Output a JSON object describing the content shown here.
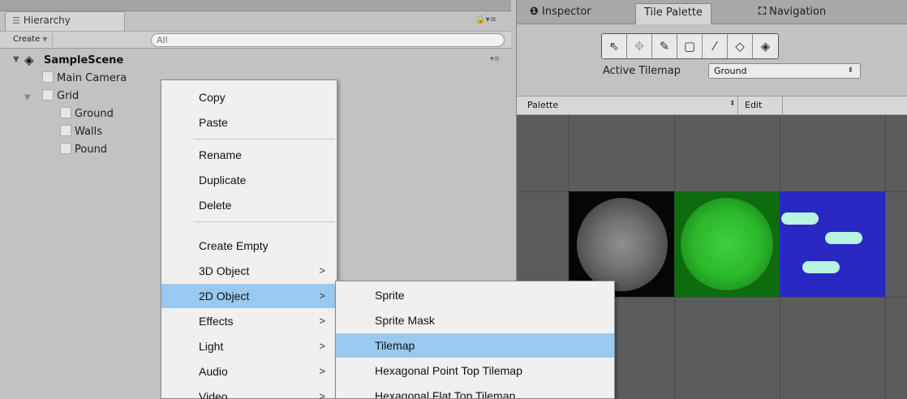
{
  "hierarchy": {
    "tab_label": "Hierarchy",
    "create_label": "Create",
    "search_placeholder": "All",
    "scene_name": "SampleScene",
    "items": [
      {
        "label": "Main Camera"
      },
      {
        "label": "Grid"
      },
      {
        "label": "Ground"
      },
      {
        "label": "Walls"
      },
      {
        "label": "Pound"
      }
    ]
  },
  "tabs": {
    "inspector": "Inspector",
    "tile_palette": "Tile Palette",
    "navigation": "Navigation"
  },
  "tile_palette": {
    "active_tilemap_label": "Active Tilemap",
    "active_tilemap_value": "Ground",
    "palette_label": "Palette",
    "edit_label": "Edit",
    "tools": [
      "select-tool-icon",
      "move-tool-icon",
      "paint-brush-icon",
      "box-fill-icon",
      "picker-icon",
      "eraser-icon",
      "fill-bucket-icon"
    ]
  },
  "context_menu": {
    "items": [
      "Copy",
      "Paste",
      "Rename",
      "Duplicate",
      "Delete",
      "Create Empty",
      "3D Object",
      "2D Object",
      "Effects",
      "Light",
      "Audio",
      "Video"
    ],
    "highlighted": "2D Object"
  },
  "submenu": {
    "items": [
      "Sprite",
      "Sprite Mask",
      "Tilemap",
      "Hexagonal Point Top Tilemap",
      "Hexagonal Flat Top Tilemap"
    ],
    "highlighted": "Tilemap"
  },
  "colors": {
    "highlight": "#99c9ef",
    "pound_tile": "#2a28c2",
    "walls_tile": "#2cb92c"
  }
}
